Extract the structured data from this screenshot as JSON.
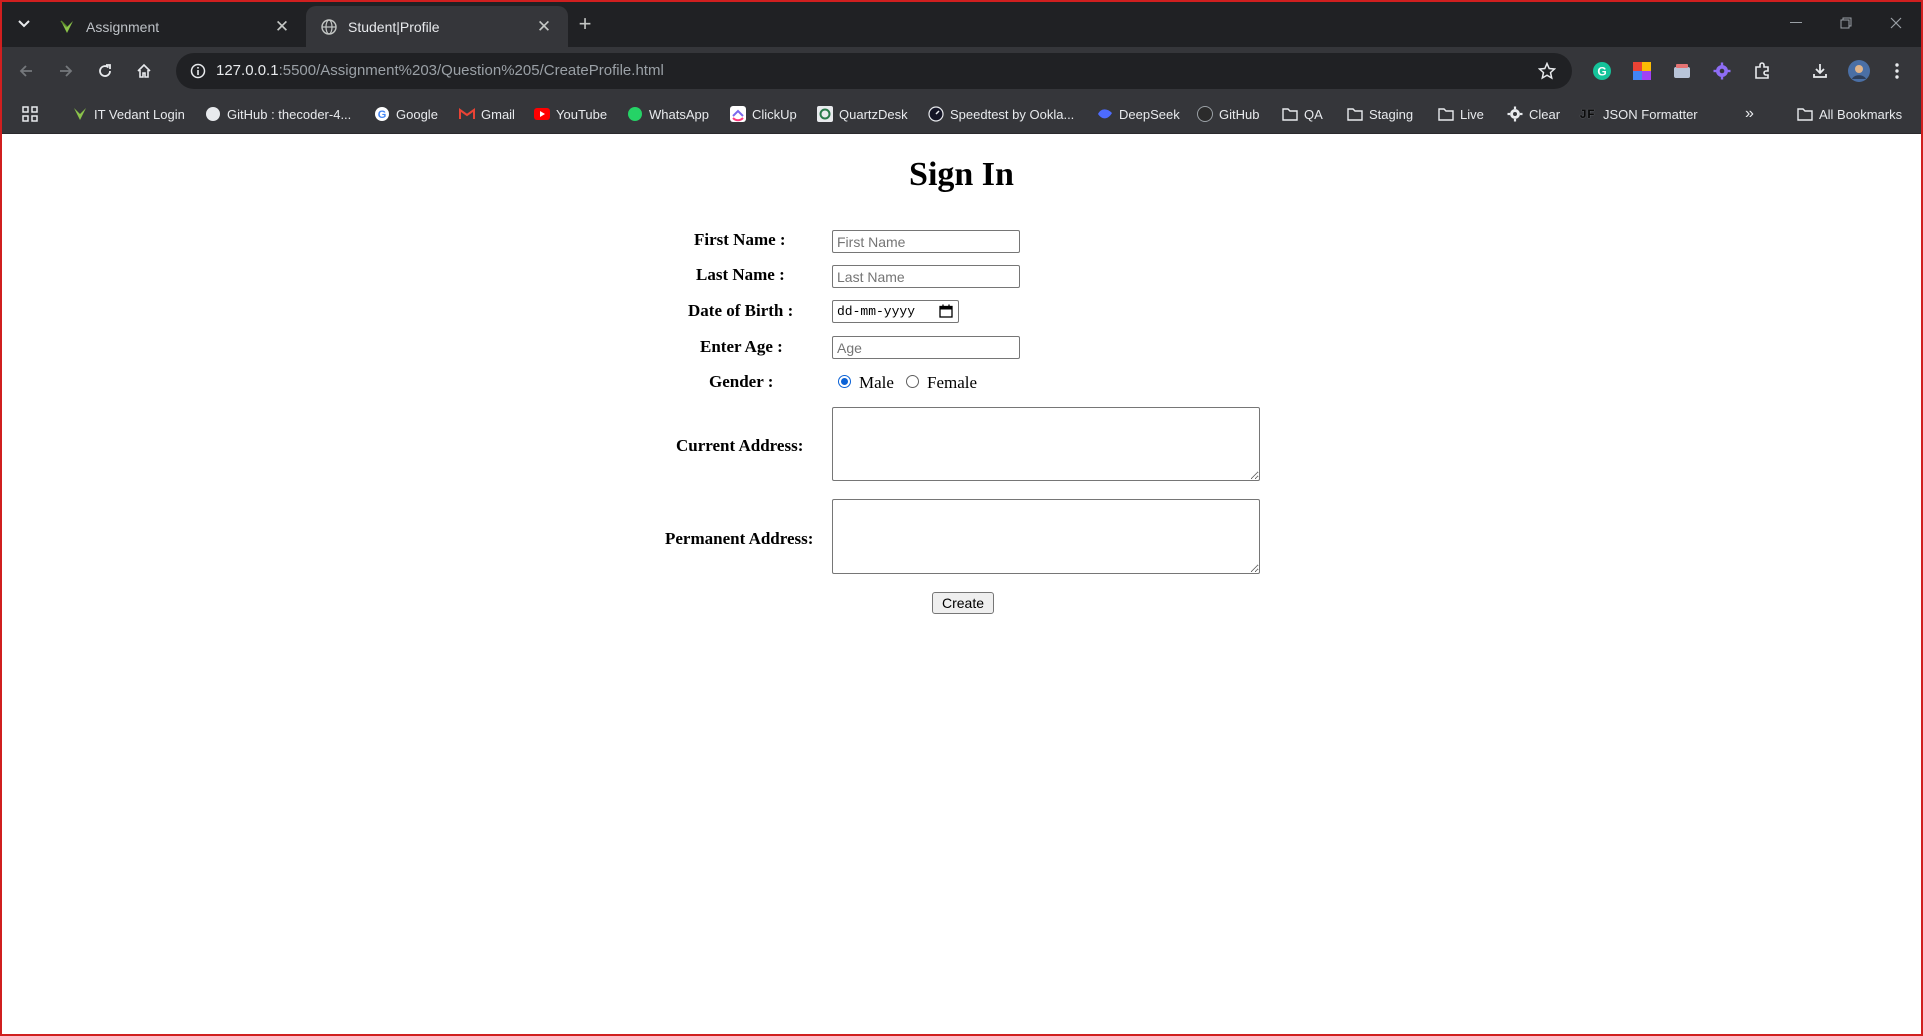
{
  "browser": {
    "tabs": [
      {
        "title": "Assignment",
        "active": false,
        "favicon": "itvedant-leaf-icon"
      },
      {
        "title": "Student|Profile",
        "active": true,
        "favicon": "globe-icon"
      }
    ],
    "url": {
      "host": "127.0.0.1",
      "path": ":5500/Assignment%203/Question%205/CreateProfile.html"
    },
    "bookmarks": [
      {
        "label": "IT Vedant Login",
        "icon": "itvedant-leaf-icon"
      },
      {
        "label": "GitHub : thecoder-4...",
        "icon": "github-icon"
      },
      {
        "label": "Google",
        "icon": "google-icon"
      },
      {
        "label": "Gmail",
        "icon": "gmail-icon"
      },
      {
        "label": "YouTube",
        "icon": "youtube-icon"
      },
      {
        "label": "WhatsApp",
        "icon": "whatsapp-icon"
      },
      {
        "label": "ClickUp",
        "icon": "clickup-icon"
      },
      {
        "label": "QuartzDesk",
        "icon": "quartzdesk-icon"
      },
      {
        "label": "Speedtest by Ookla...",
        "icon": "speedtest-icon"
      },
      {
        "label": "DeepSeek",
        "icon": "deepseek-icon"
      },
      {
        "label": "GitHub",
        "icon": "github-icon"
      },
      {
        "label": "QA",
        "icon": "folder-icon"
      },
      {
        "label": "Staging",
        "icon": "folder-icon"
      },
      {
        "label": "Live",
        "icon": "folder-icon"
      },
      {
        "label": "Clear",
        "icon": "gear-icon"
      },
      {
        "label": "JSON Formatter",
        "icon": "json-formatter-icon"
      }
    ],
    "all_bookmarks": "All Bookmarks",
    "overflow": "»"
  },
  "form": {
    "title": "Sign In",
    "first_name": {
      "label": "First Name :",
      "placeholder": "First Name"
    },
    "last_name": {
      "label": "Last Name :",
      "placeholder": "Last Name"
    },
    "dob": {
      "label": "Date of Birth :",
      "value": "dd-mm-yyyy"
    },
    "age": {
      "label": "Enter Age :",
      "placeholder": "Age"
    },
    "gender": {
      "label": "Gender :",
      "options": [
        "Male",
        "Female"
      ],
      "selected": "Male"
    },
    "current_address": {
      "label": "Current Address:"
    },
    "permanent_address": {
      "label": "Permanent Address:"
    },
    "submit": "Create"
  }
}
